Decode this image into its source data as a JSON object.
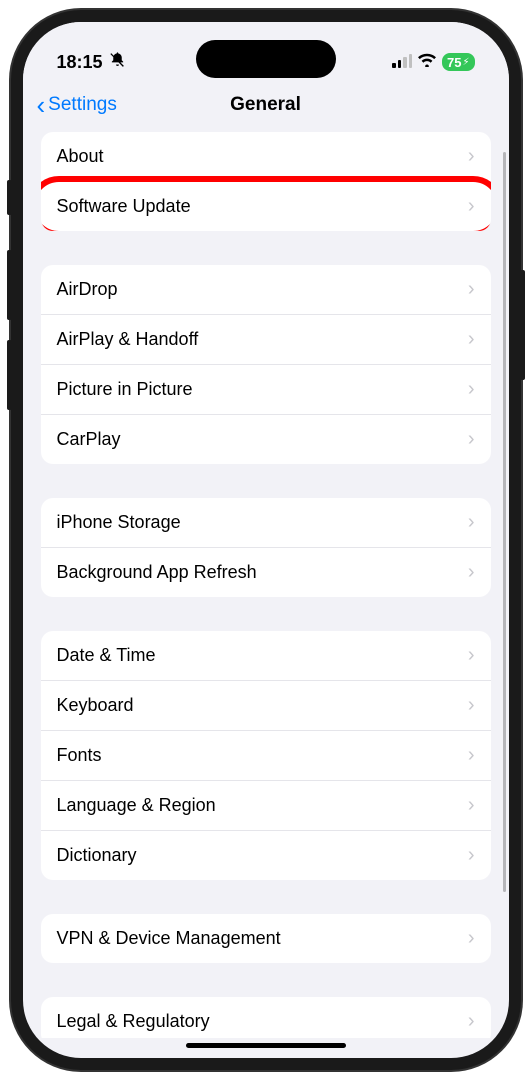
{
  "status": {
    "time": "18:15",
    "battery_pct": "75"
  },
  "nav": {
    "back_label": "Settings",
    "title": "General"
  },
  "sections": [
    {
      "items": [
        {
          "label": "About",
          "name": "row-about"
        },
        {
          "label": "Software Update",
          "name": "row-software-update",
          "highlight": true
        }
      ]
    },
    {
      "items": [
        {
          "label": "AirDrop",
          "name": "row-airdrop"
        },
        {
          "label": "AirPlay & Handoff",
          "name": "row-airplay-handoff"
        },
        {
          "label": "Picture in Picture",
          "name": "row-picture-in-picture"
        },
        {
          "label": "CarPlay",
          "name": "row-carplay"
        }
      ]
    },
    {
      "items": [
        {
          "label": "iPhone Storage",
          "name": "row-iphone-storage"
        },
        {
          "label": "Background App Refresh",
          "name": "row-background-app-refresh"
        }
      ]
    },
    {
      "items": [
        {
          "label": "Date & Time",
          "name": "row-date-time"
        },
        {
          "label": "Keyboard",
          "name": "row-keyboard"
        },
        {
          "label": "Fonts",
          "name": "row-fonts"
        },
        {
          "label": "Language & Region",
          "name": "row-language-region"
        },
        {
          "label": "Dictionary",
          "name": "row-dictionary"
        }
      ]
    },
    {
      "items": [
        {
          "label": "VPN & Device Management",
          "name": "row-vpn-device-management"
        }
      ]
    },
    {
      "items": [
        {
          "label": "Legal & Regulatory",
          "name": "row-legal-regulatory"
        }
      ]
    }
  ]
}
